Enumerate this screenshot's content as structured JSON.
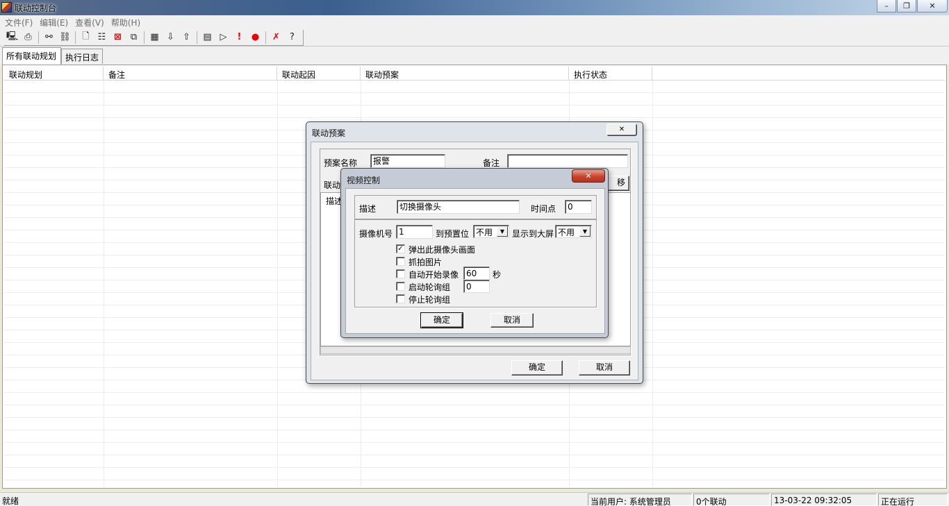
{
  "window": {
    "title": "联动控制台",
    "minimize_glyph": "–",
    "maximize_glyph": "❐",
    "close_glyph": "✕"
  },
  "menu": [
    "文件(F)",
    "编辑(E)",
    "查看(V)",
    "帮助(H)"
  ],
  "toolbar": {
    "icons": [
      "computer-icon",
      "printer-icon",
      "link-icon",
      "flowchart-icon",
      "new-file-icon",
      "properties-icon",
      "delete-icon",
      "copy-icon",
      "calendar-icon",
      "sort-down-icon",
      "sort-up-icon",
      "page-icon",
      "play-icon",
      "exclamation-icon",
      "record-icon",
      "clear-icon",
      "help-icon"
    ]
  },
  "tabs": [
    "所有联动规划",
    "执行日志"
  ],
  "list": {
    "columns": [
      "联动规划",
      "备注",
      "联动起因",
      "联动预案",
      "执行状态"
    ]
  },
  "status": {
    "ready": "就绪",
    "user": "当前用户: 系统管理员",
    "count": "0个联动",
    "time": "13-03-22 09:32:05",
    "state": "正在运行"
  },
  "plan_dialog": {
    "title": "联动预案",
    "close_glyph": "✕",
    "name_label": "预案名称",
    "name_value": "报警",
    "note_label": "备注",
    "note_value": "",
    "action_label": "联动",
    "move_button": "移",
    "desc_header": "描述",
    "ok": "确定",
    "cancel": "取消"
  },
  "video_dialog": {
    "title": "视频控制",
    "close_glyph": "✕",
    "desc_label": "描述",
    "desc_value": "切换摄像头",
    "timepoint_label": "时间点",
    "timepoint_value": "0",
    "camera_label": "摄像机号",
    "camera_value": "1",
    "preset_label": "到预置位",
    "preset_value": "不用",
    "screen_label": "显示到大屏",
    "screen_value": "不用",
    "options": [
      {
        "label": "弹出此摄像头画面",
        "checked": true
      },
      {
        "label": "抓拍图片",
        "checked": false
      },
      {
        "label": "自动开始录像",
        "checked": false
      },
      {
        "label": "启动轮询组",
        "checked": false
      },
      {
        "label": "停止轮询组",
        "checked": false
      }
    ],
    "record_seconds": "60",
    "seconds_unit": "秒",
    "poll_group_value": "0",
    "ok": "确定",
    "cancel": "取消"
  }
}
